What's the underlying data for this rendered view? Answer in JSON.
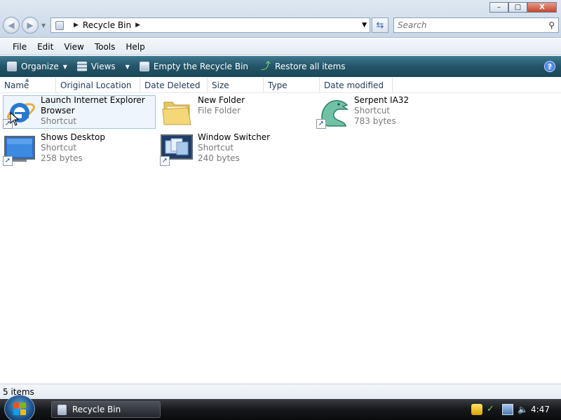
{
  "window": {
    "controls": {
      "minimize": "–",
      "maximize": "□",
      "close": "X"
    }
  },
  "address": {
    "location": "Recycle Bin",
    "arrow": "▶",
    "dropdown": "▼"
  },
  "search": {
    "placeholder": "Search",
    "icon": "search-icon"
  },
  "menu": [
    "File",
    "Edit",
    "View",
    "Tools",
    "Help"
  ],
  "commands": {
    "organize": "Organize",
    "views": "Views",
    "empty_bin": "Empty the Recycle Bin",
    "restore_all": "Restore all items",
    "help": "?"
  },
  "columns": [
    "Name",
    "Original Location",
    "Date Deleted",
    "Size",
    "Type",
    "Date modified"
  ],
  "items": [
    {
      "name_line1": "Launch Internet Explorer",
      "name_line2": "Browser",
      "type": "Shortcut",
      "size": "",
      "icon": "internet-explorer-icon",
      "selected": true
    },
    {
      "name_line1": "New Folder",
      "name_line2": "",
      "type": "File Folder",
      "size": "",
      "icon": "folder-icon",
      "selected": false
    },
    {
      "name_line1": "Serpent IA32",
      "name_line2": "",
      "type": "Shortcut",
      "size": "783 bytes",
      "icon": "serpent-dragon-icon",
      "selected": false
    },
    {
      "name_line1": "Shows Desktop",
      "name_line2": "",
      "type": "Shortcut",
      "size": "258 bytes",
      "icon": "show-desktop-icon",
      "selected": false
    },
    {
      "name_line1": "Window Switcher",
      "name_line2": "",
      "type": "Shortcut",
      "size": "240 bytes",
      "icon": "window-switcher-icon",
      "selected": false
    }
  ],
  "status": {
    "count": "5 items"
  },
  "taskbar": {
    "active_window": "Recycle Bin",
    "clock": "4:47"
  },
  "colors": {
    "command_bar": "#235468",
    "selection": "#eef5fc",
    "selection_border": "#a3c4e3",
    "taskbar": "#15171a"
  }
}
